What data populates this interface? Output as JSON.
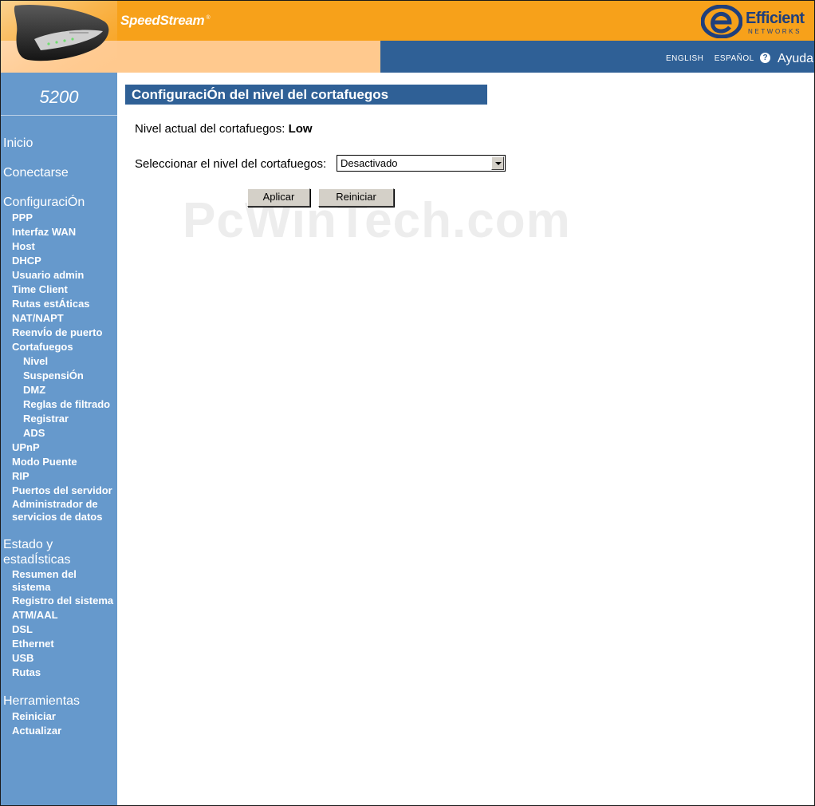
{
  "header": {
    "brand": "SpeedStream",
    "brand_mark": "®",
    "logo_word": "Efficient",
    "logo_sub": "NETWORKS",
    "languages": [
      "ENGLISH",
      "ESPAÑOL"
    ],
    "help_label": "Ayuda",
    "colors": {
      "top_bar": "#f7a11a",
      "sub_bar": "#2f6096",
      "sidebar": "#6699cc"
    }
  },
  "sidebar": {
    "model": "5200",
    "sections": [
      {
        "label": "Inicio"
      },
      {
        "label": "Conectarse"
      },
      {
        "label": "ConfiguraciÓn",
        "items": [
          "PPP",
          "Interfaz WAN",
          "Host",
          "DHCP",
          "Usuario admin",
          "Time Client",
          "Rutas estÁticas",
          "NAT/NAPT",
          "ReenvÍo de puerto",
          "Cortafuegos"
        ],
        "firewall_items": [
          "Nivel",
          "SuspensiÓn",
          "DMZ",
          "Reglas de filtrado",
          "Registrar",
          "ADS"
        ],
        "after_items": [
          "UPnP",
          "Modo Puente",
          "RIP",
          "Puertos del servidor",
          "Administrador de servicios de datos"
        ]
      },
      {
        "label": "Estado y estadÍsticas",
        "items": [
          "Resumen del sistema",
          "Registro del sistema",
          "ATM/AAL",
          "DSL",
          "Ethernet",
          "USB",
          "Rutas"
        ]
      },
      {
        "label": "Herramientas",
        "items": [
          "Reiniciar",
          "Actualizar"
        ]
      }
    ]
  },
  "main": {
    "title": "ConfiguraciÓn del nivel del cortafuegos",
    "current_label": "Nivel actual del cortafuegos:",
    "current_value": "Low",
    "select_label": "Seleccionar el nivel del cortafuegos:",
    "select_value": "Desactivado",
    "apply_button": "Aplicar",
    "reset_button": "Reiniciar",
    "watermark": "PcWinTech.com"
  }
}
